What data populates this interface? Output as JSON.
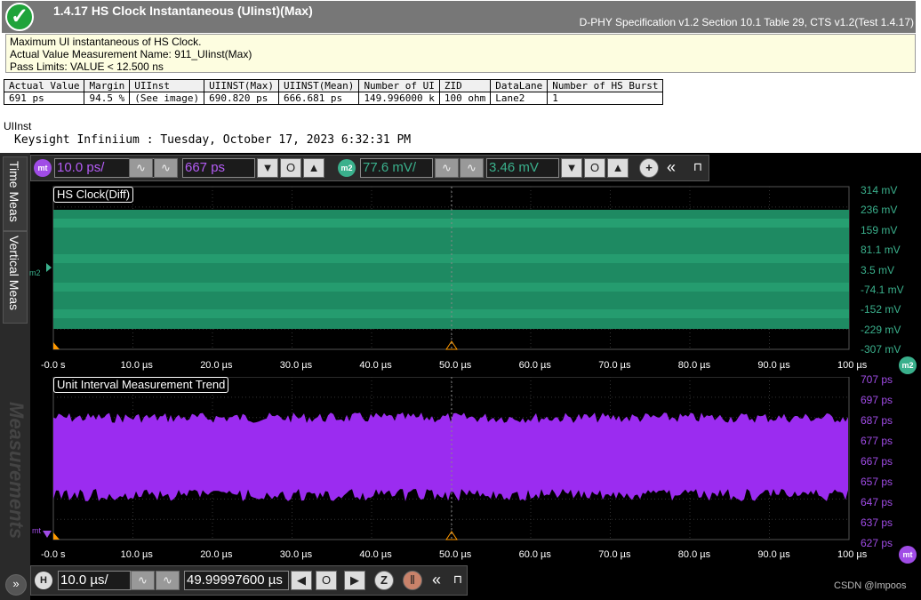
{
  "header": {
    "status_icon": "checkmark-icon",
    "title": "1.4.17 HS Clock Instantaneous (UIinst)(Max)",
    "spec": "D-PHY Specification v1.2 Section 10.1 Table 29, CTS v1.2(Test 1.4.17)"
  },
  "info": {
    "line1": "Maximum UI instantaneous of HS Clock.",
    "line2": "Actual Value Measurement Name: 911_UIinst(Max)",
    "line3": "Pass Limits: VALUE < 12.500 ns"
  },
  "results": {
    "headers": [
      "Actual Value",
      "Margin",
      "UIInst",
      "UIINST(Max)",
      "UIINST(Mean)",
      "Number of UI",
      "ZID",
      "DataLane",
      "Number of HS Burst"
    ],
    "row": [
      "691 ps",
      "94.5 %",
      "(See image)",
      "690.820 ps",
      "666.681 ps",
      "149.996000 k",
      "100 ohm",
      "Lane2",
      "1"
    ]
  },
  "image_label": "UIInst",
  "keysight_line": "Keysight Infiniium : Tuesday, October 17, 2023 6:32:31 PM",
  "sidebar": {
    "tab1": "Time Meas",
    "tab2": "Vertical Meas",
    "watermark": "Measurements"
  },
  "toolbar_top": {
    "m1_badge": "mt",
    "m1_scale": "10.0 ps/",
    "m1_offset": "667 ps",
    "m2_badge": "m2",
    "m2_scale": "77.6 mV/",
    "m2_offset": "3.46 mV",
    "down_icon": "▼",
    "zero_icon": "O",
    "up_icon": "▲",
    "plus_icon": "+",
    "collapse_icon": "«",
    "pin_icon": "⊓"
  },
  "panel1": {
    "title": "HS Clock(Diff)",
    "marker": "m2",
    "yticks": [
      "314 mV",
      "236 mV",
      "159 mV",
      "81.1 mV",
      "3.5 mV",
      "-74.1 mV",
      "-152 mV",
      "-229 mV",
      "-307 mV"
    ],
    "xticks": [
      "-0.0 s",
      "10.0 µs",
      "20.0 µs",
      "30.0 µs",
      "40.0 µs",
      "50.0 µs",
      "60.0 µs",
      "70.0 µs",
      "80.0 µs",
      "90.0 µs",
      "100 µs"
    ],
    "badge": "m2"
  },
  "panel2": {
    "title": "Unit Interval Measurement Trend",
    "marker": "mt",
    "yticks": [
      "707 ps",
      "697 ps",
      "687 ps",
      "677 ps",
      "667 ps",
      "657 ps",
      "647 ps",
      "637 ps",
      "627 ps"
    ],
    "xticks": [
      "-0.0 s",
      "10.0 µs",
      "20.0 µs",
      "30.0 µs",
      "40.0 µs",
      "50.0 µs",
      "60.0 µs",
      "70.0 µs",
      "80.0 µs",
      "90.0 µs",
      "100 µs"
    ],
    "badge": "mt"
  },
  "toolbar_bottom": {
    "h_badge": "H",
    "h_scale": "10.0 µs/",
    "h_position": "49.99997600 µs",
    "left_icon": "◀",
    "zero_icon": "O",
    "right_icon": "▶",
    "zoom_icon": "Z",
    "collapse_icon": "«",
    "pin_icon": "⊓",
    "expand_icon": "»"
  },
  "colors": {
    "clock": "#1e8a62",
    "trend": "#9b2cf0",
    "m2": "#3ab08c",
    "mt": "#a04ce6"
  },
  "watermark_credit": "CSDN @Impoos"
}
